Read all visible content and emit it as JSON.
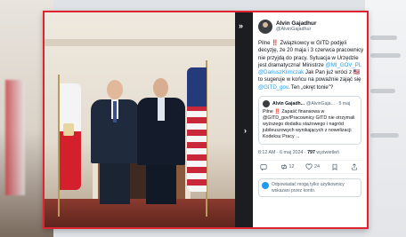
{
  "tweet": {
    "author_name": "Alvin Gajadhur",
    "author_handle": "@AlvinGajadhur",
    "text_1": "Pilne ‼️ Związkowcy w GITD podjęli decyzję, że 20 maja i 3 czerwca pracownicy nie przyjdą do pracy. Sytuacja w Urzędzie jest dramatyczna! Ministrze ",
    "mention_1": "@MI_GOV_PL",
    "text_2": " ",
    "mention_2": "@DariuszKlimczak",
    "text_3": " Jak Pan już wróci z 🇺🇸 to sugeruje w końcu na poważnie zająć się ",
    "mention_3": "@GITD_gov",
    "text_4": ". Ten „okręt tonie”?",
    "timestamp": "8:12 AM · 6 maj 2024",
    "views_count": "797",
    "views_label": "wyświetleń",
    "replies": "",
    "retweets": "12",
    "likes": "24",
    "reply_note": "Odpowiadać mogą tylko użytkownicy wskazani przez konto."
  },
  "quote": {
    "author_name": "Alvin Gajadh...",
    "author_handle": "@AlvinGaja... · 5 maj",
    "text": "Pilne ‼️ Zapaść finansowa w @GITD_gov!Pracownicy GITD nie otrzymali wyższego dodatku stażowego i nagród jubileuszowych wynikających z nowelizacji Kodeksu Pracy ..."
  },
  "icons": {
    "close": "close-icon",
    "next": "chevron-right-icon",
    "reply": "reply-icon",
    "retweet": "retweet-icon",
    "like": "heart-icon",
    "bookmark": "bookmark-icon",
    "share": "share-icon"
  },
  "colors": {
    "frame_border": "#e0242f",
    "link": "#1d9bf0"
  }
}
